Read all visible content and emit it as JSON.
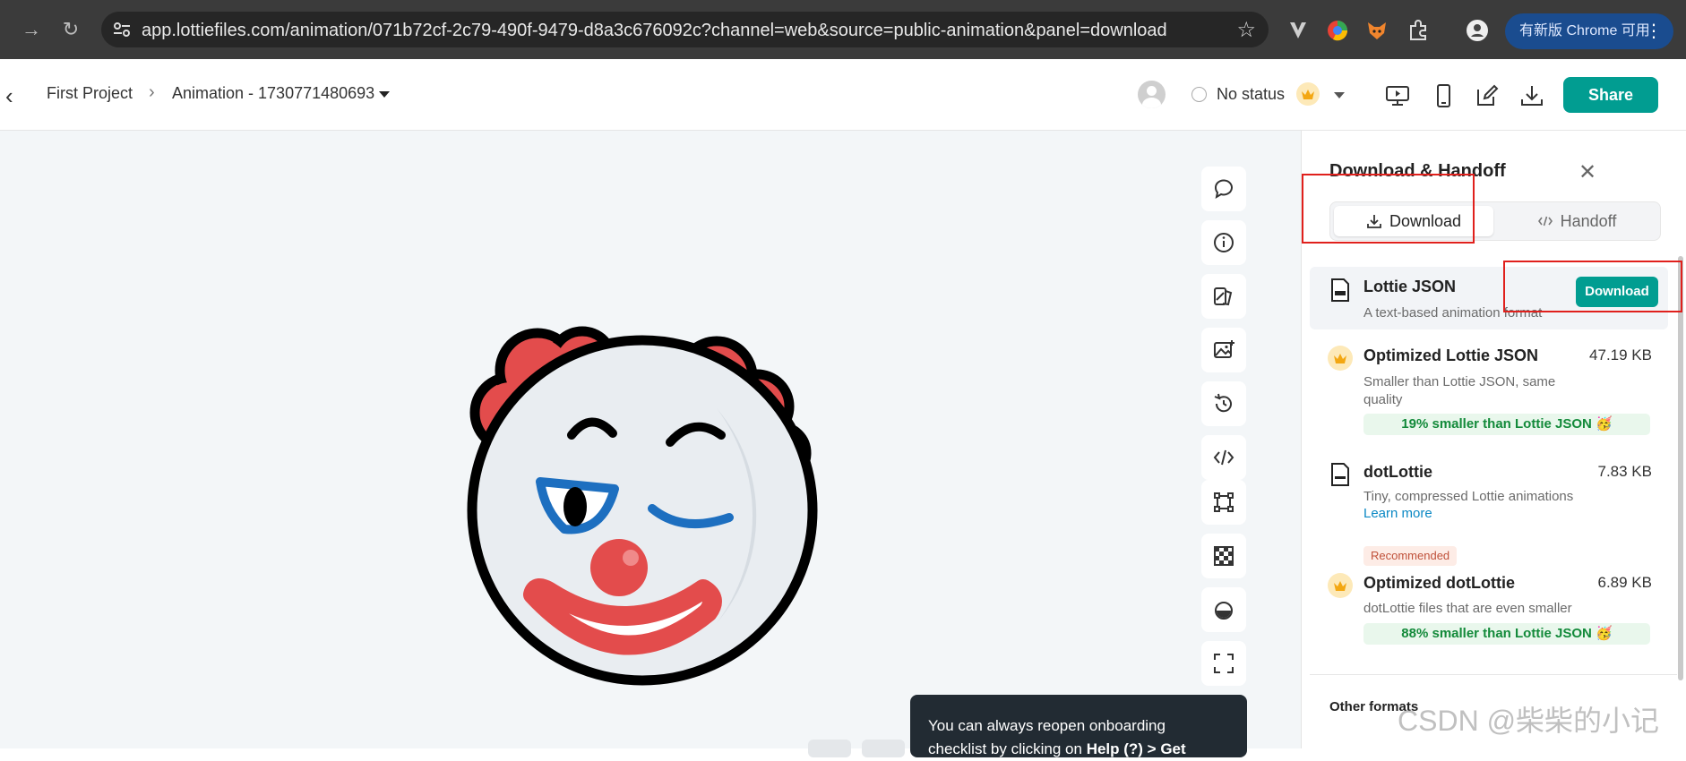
{
  "browser": {
    "url": "app.lottiefiles.com/animation/071b72cf-2c79-490f-9479-d8a3c676092c?channel=web&source=public-animation&panel=download",
    "update_label": "有新版 Chrome 可用",
    "more_glyph": "⋮"
  },
  "header": {
    "back_glyph": "‹",
    "breadcrumb_project": "First Project",
    "breadcrumb_sep": "›",
    "breadcrumb_animation": "Animation - 1730771480693",
    "status": "No status",
    "share_label": "Share"
  },
  "panel": {
    "title": "Download & Handoff",
    "close_glyph": "✕",
    "tabs": [
      "Download",
      "Handoff"
    ],
    "formats": [
      {
        "name": "Lottie JSON",
        "desc": "A text-based animation format",
        "action": "Download"
      },
      {
        "name": "Optimized Lottie JSON",
        "desc": "Smaller than Lottie JSON, same quality",
        "size": "47.19 KB",
        "saving": "19% smaller than Lottie JSON 🥳"
      },
      {
        "name": "dotLottie",
        "desc": "Tiny, compressed Lottie animations",
        "link": "Learn more",
        "size": "7.83 KB"
      },
      {
        "badge": "Recommended",
        "name": "Optimized dotLottie",
        "desc": "dotLottie files that are even smaller",
        "size": "6.89 KB",
        "saving": "88% smaller than Lottie JSON 🥳"
      }
    ],
    "other_formats": "Other formats"
  },
  "toast": {
    "line1": "You can always reopen onboarding",
    "line2_a": "checklist by clicking on ",
    "line2_b": "Help (?) > Get"
  },
  "watermark": "CSDN @柴柴的小记",
  "colors": {
    "brand": "#019d91",
    "highlight_box": "#e0201c",
    "browser_bg": "#3b3b3b"
  }
}
